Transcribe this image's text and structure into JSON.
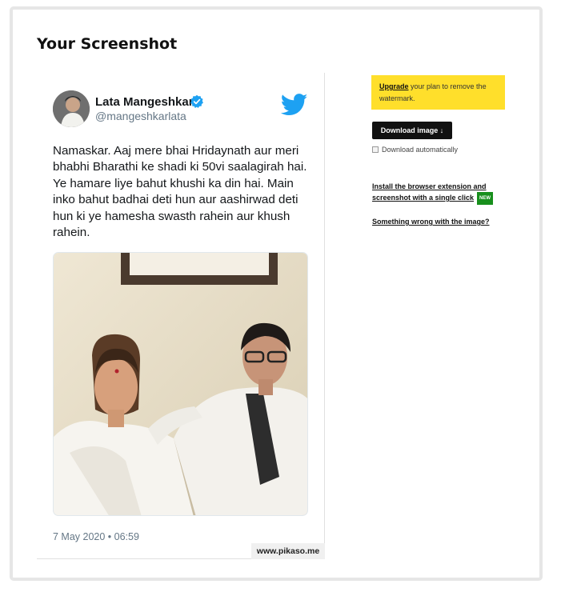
{
  "page": {
    "title": "Your Screenshot"
  },
  "tweet": {
    "user_name": "Lata Mangeshkar",
    "user_handle": "@mangeshkarlata",
    "text": "Namaskar. Aaj mere bhai Hridaynath aur meri bhabhi Bharathi ke shadi ki 50vi saalagirah hai. Ye hamare liye bahut khushi ka din hai. Main inko bahut badhai deti hun aur aashirwad deti hun ki ye hamesha swasth rahein aur khush rahein.",
    "date": "7 May 2020 • 06:59",
    "watermark": "www.pikaso.me"
  },
  "sidebar": {
    "upgrade_link": "Upgrade",
    "upgrade_text": " your plan to remove the watermark.",
    "download_label": "Download image ↓",
    "auto_download_label": "Download automatically",
    "extension_link": "Install the browser extension and screenshot with a single click",
    "new_badge": "NEW",
    "wrong_link": "Something wrong with the image?"
  },
  "colors": {
    "upgrade_bg": "#ffdf2b",
    "twitter_blue": "#1da1f2",
    "badge_green": "#178f1c"
  },
  "icons": [
    "verified-icon",
    "twitter-logo-icon",
    "checkbox-icon"
  ]
}
